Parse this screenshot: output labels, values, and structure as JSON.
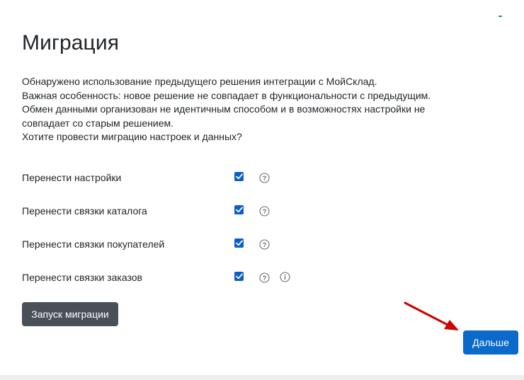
{
  "page": {
    "title": "Миграция",
    "description_lines": [
      "Обнаружено использование предыдущего решения интеграции с МойСклад.",
      "Важная особенность: новое решение не совпадает в функциональности с предыдущим.",
      "Обмен данными организован не идентичным способом и в возможностях настройки не",
      "совпадает со старым решением.",
      "Хотите провести миграцию настроек и данных?"
    ]
  },
  "options": [
    {
      "label": "Перенести настройки",
      "checked": true,
      "help_icon": "question-circle-icon"
    },
    {
      "label": "Перенести связки каталога",
      "checked": true,
      "help_icon": "question-circle-icon"
    },
    {
      "label": "Перенести связки покупателей",
      "checked": true,
      "help_icon": "question-circle-icon"
    },
    {
      "label": "Перенести связки заказов",
      "checked": true,
      "help_icon": "question-circle-icon",
      "info_icon": "info-circle-icon"
    }
  ],
  "buttons": {
    "start_migration": "Запуск миграции",
    "next": "Дальше"
  },
  "colors": {
    "checkbox": "#0b5ec9",
    "start_button": "#4a5058",
    "next_button": "#0b6ac9",
    "annotation_arrow": "#cc0000"
  }
}
